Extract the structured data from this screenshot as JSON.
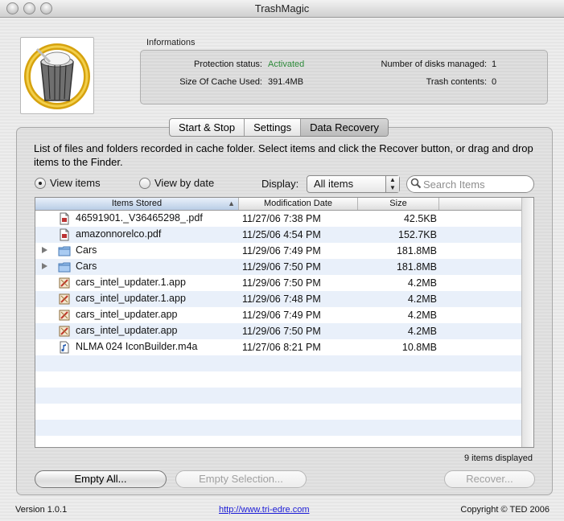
{
  "window": {
    "title": "TrashMagic"
  },
  "info": {
    "section_label": "Informations",
    "protection_status_label": "Protection status:",
    "protection_status_value": "Activated",
    "cache_size_label": "Size Of Cache Used:",
    "cache_size_value": "391.4MB",
    "disks_label": "Number of disks managed:",
    "disks_value": "1",
    "trash_label": "Trash contents:",
    "trash_value": "0"
  },
  "tabs": [
    {
      "label": "Start & Stop",
      "selected": false
    },
    {
      "label": "Settings",
      "selected": false
    },
    {
      "label": "Data Recovery",
      "selected": true
    }
  ],
  "description": "List of files and folders recorded in cache folder. Select items and click the Recover button, or drag and drop items to the Finder.",
  "view": {
    "items_label": "View items",
    "date_label": "View by date",
    "selected": "items"
  },
  "display": {
    "label": "Display:",
    "value": "All items"
  },
  "search": {
    "placeholder": "Search Items",
    "value": ""
  },
  "table": {
    "columns": [
      "Items Stored",
      "Modification Date",
      "Size"
    ],
    "rows": [
      {
        "name": "46591901._V36465298_.pdf",
        "date": "11/27/06 7:38 PM",
        "size": "42.5KB",
        "icon": "pdf-file-icon",
        "expandable": false
      },
      {
        "name": "amazonnorelco.pdf",
        "date": "11/25/06 4:54 PM",
        "size": "152.7KB",
        "icon": "pdf-file-icon",
        "expandable": false
      },
      {
        "name": "Cars",
        "date": "11/29/06 7:49 PM",
        "size": "181.8MB",
        "icon": "folder-icon",
        "expandable": true
      },
      {
        "name": "Cars",
        "date": "11/29/06 7:50 PM",
        "size": "181.8MB",
        "icon": "folder-icon",
        "expandable": true
      },
      {
        "name": "cars_intel_updater.1.app",
        "date": "11/29/06 7:50 PM",
        "size": "4.2MB",
        "icon": "app-icon",
        "expandable": false
      },
      {
        "name": "cars_intel_updater.1.app",
        "date": "11/29/06 7:48 PM",
        "size": "4.2MB",
        "icon": "app-icon",
        "expandable": false
      },
      {
        "name": "cars_intel_updater.app",
        "date": "11/29/06 7:49 PM",
        "size": "4.2MB",
        "icon": "app-icon",
        "expandable": false
      },
      {
        "name": "cars_intel_updater.app",
        "date": "11/29/06 7:50 PM",
        "size": "4.2MB",
        "icon": "app-icon",
        "expandable": false
      },
      {
        "name": "NLMA 024 IconBuilder.m4a",
        "date": "11/27/06 8:21 PM",
        "size": "10.8MB",
        "icon": "audio-file-icon",
        "expandable": false
      }
    ]
  },
  "status": {
    "count_text": "9 items displayed"
  },
  "buttons": {
    "empty_all": "Empty All...",
    "empty_selection": "Empty Selection...",
    "recover": "Recover..."
  },
  "footer": {
    "version": "Version 1.0.1",
    "url": "http://www.tri-edre.com",
    "copyright": "Copyright © TED 2006"
  },
  "colors": {
    "accent_green": "#2e8a3a",
    "row_stripe": "#e9f0fa",
    "link": "#1a1ad6"
  }
}
